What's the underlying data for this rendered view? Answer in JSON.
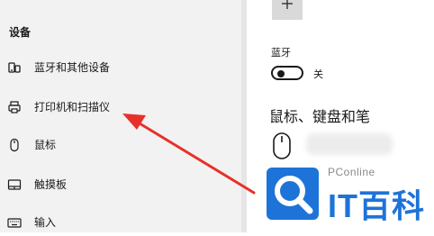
{
  "sidebar": {
    "section_title": "设备",
    "items": [
      {
        "label": "蓝牙和其他设备",
        "icon": "bluetooth-devices-icon"
      },
      {
        "label": "打印机和扫描仪",
        "icon": "printer-icon"
      },
      {
        "label": "鼠标",
        "icon": "mouse-icon"
      },
      {
        "label": "触摸板",
        "icon": "touchpad-icon"
      },
      {
        "label": "输入",
        "icon": "keyboard-icon"
      }
    ]
  },
  "main": {
    "add_icon": "plus-icon",
    "bluetooth_label": "蓝牙",
    "bluetooth_state": "关",
    "mouse_keyboard_heading": "鼠标、键盘和笔",
    "mouse_device_icon": "mouse-icon"
  },
  "watermark": {
    "brand": "PConline",
    "name": "IT百科"
  },
  "colors": {
    "sidebar_bg": "#f2f2f2",
    "arrow": "#e8302a",
    "watermark_blue": "#1e73d8"
  }
}
